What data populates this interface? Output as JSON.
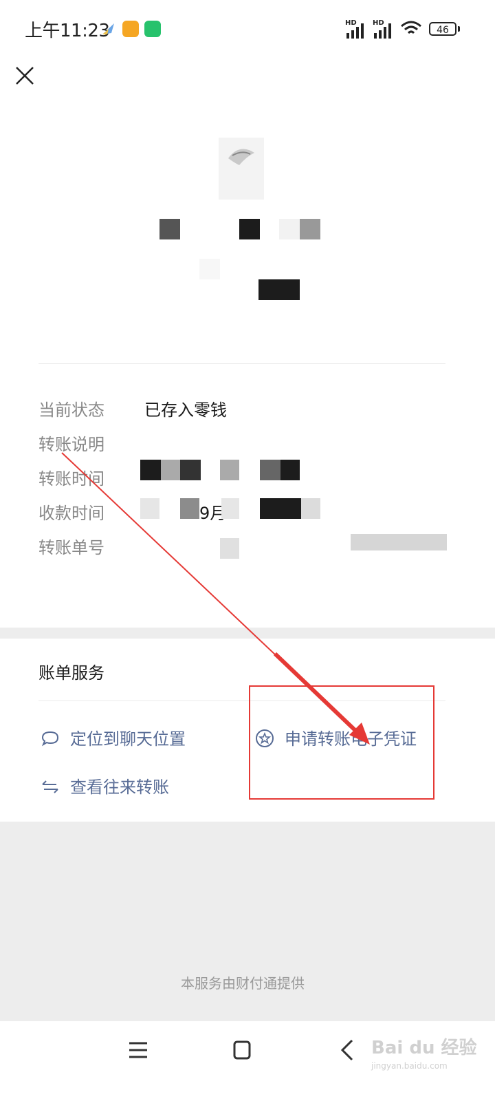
{
  "status_bar": {
    "time": "上午11:23",
    "network_labels": [
      "HD",
      "HD"
    ],
    "battery": "46"
  },
  "icons": {
    "close": "close-icon",
    "chat": "chat-bubble-icon",
    "star": "star-circle-icon",
    "exchange": "exchange-arrows-icon"
  },
  "details": [
    {
      "label": "当前状态",
      "value": "已存入零钱"
    },
    {
      "label": "转账说明",
      "value": ""
    },
    {
      "label": "转账时间",
      "value": ""
    },
    {
      "label": "收款时间",
      "value": "9月"
    },
    {
      "label": "转账单号",
      "value": ""
    }
  ],
  "bill_service": {
    "title": "账单服务",
    "items": [
      {
        "label": "定位到聊天位置",
        "icon": "chat-bubble-icon"
      },
      {
        "label": "申请转账电子凭证",
        "icon": "star-circle-icon"
      },
      {
        "label": "查看往来转账",
        "icon": "exchange-arrows-icon"
      }
    ]
  },
  "footer": "本服务由财付通提供",
  "watermark": {
    "brand": "Bai du 经验",
    "url": "jingyan.baidu.com"
  },
  "colors": {
    "link": "#576b95",
    "label": "#888888",
    "annotation": "#e53935",
    "gray_bg": "#ededed"
  }
}
